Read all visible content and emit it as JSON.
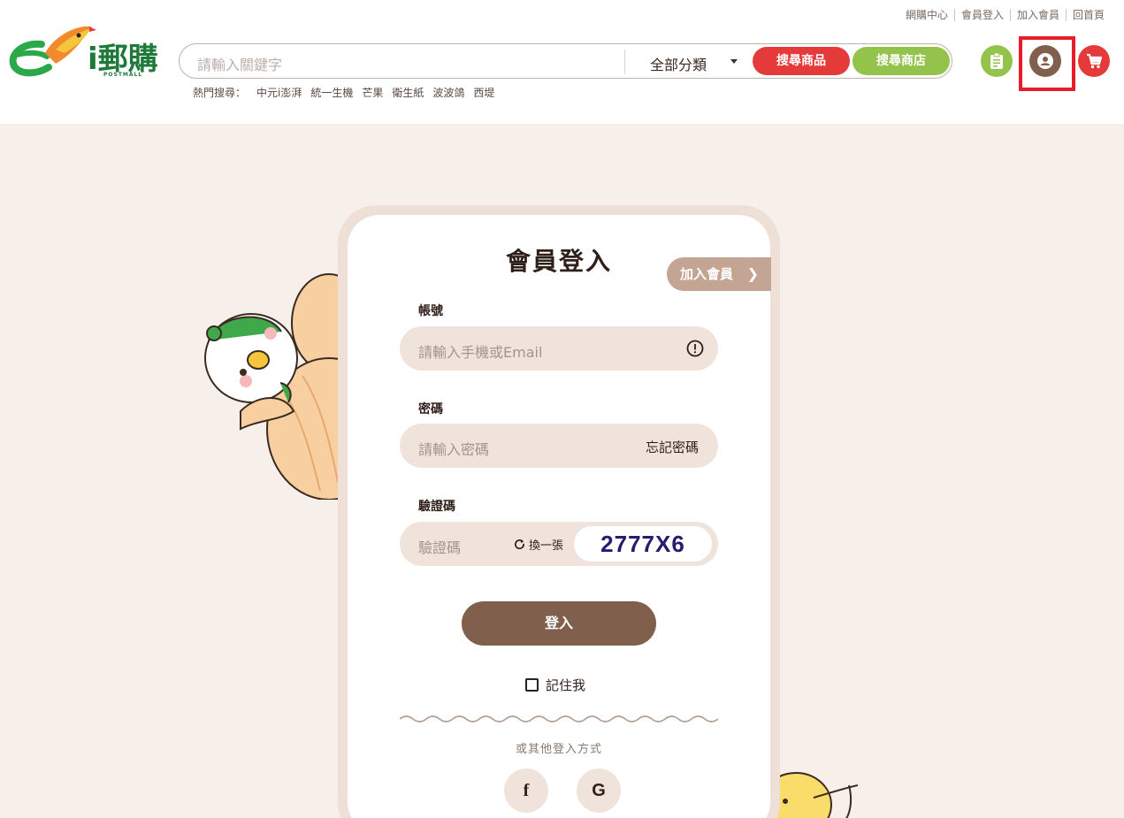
{
  "header": {
    "top_links": [
      "網購中心",
      "會員登入",
      "加入會員",
      "回首頁"
    ],
    "logo_text": "i郵購",
    "logo_sub": "POSTMALL",
    "search": {
      "placeholder": "請輸入關鍵字",
      "category": "全部分類",
      "search_products_label": "搜尋商品",
      "search_shops_label": "搜尋商店"
    },
    "hot_search": {
      "label": "熱門搜尋：",
      "items": [
        "中元i澎湃",
        "統一生機",
        "芒果",
        "衛生紙",
        "波波鴿",
        "西堤"
      ]
    },
    "icons": {
      "orders": "clipboard-icon",
      "member": "user-icon",
      "cart": "cart-icon"
    }
  },
  "login": {
    "title": "會員登入",
    "join_tab": "加入會員",
    "account_label": "帳號",
    "account_placeholder": "請輸入手機或Email",
    "password_label": "密碼",
    "password_placeholder": "請輸入密碼",
    "forgot_password": "忘記密碼",
    "captcha_label": "驗證碼",
    "captcha_placeholder": "驗證碼",
    "refresh_label": "換一張",
    "captcha_code": "2777X6",
    "login_button": "登入",
    "remember_me": "記住我",
    "other_login": "或其他登入方式",
    "social": [
      "f",
      "G"
    ]
  },
  "colors": {
    "brand_brown": "#80604c",
    "red": "#e53a3a",
    "green": "#94c34c",
    "field_bg": "#f0e3db",
    "highlight": "#e81c2a"
  }
}
